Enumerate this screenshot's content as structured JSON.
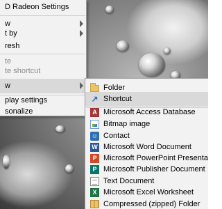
{
  "context_menu": {
    "items": [
      {
        "label": "D Radeon Settings",
        "disabled": false,
        "has_submenu": false
      },
      {
        "label": "w",
        "disabled": false,
        "has_submenu": true
      },
      {
        "label": "t by",
        "disabled": false,
        "has_submenu": true
      },
      {
        "label": "resh",
        "disabled": false,
        "has_submenu": false
      },
      {
        "label": "te",
        "disabled": true,
        "has_submenu": false
      },
      {
        "label": "te shortcut",
        "disabled": true,
        "has_submenu": false
      },
      {
        "label": "w",
        "disabled": false,
        "has_submenu": true,
        "highlighted": true
      },
      {
        "label": "play settings",
        "disabled": false,
        "has_submenu": false
      },
      {
        "label": "sonalize",
        "disabled": false,
        "has_submenu": false
      }
    ]
  },
  "new_submenu": {
    "items": [
      {
        "label": "Folder",
        "icon": "folder-icon"
      },
      {
        "label": "Shortcut",
        "icon": "shortcut-icon"
      },
      {
        "label": "Microsoft Access Database",
        "icon": "access-icon"
      },
      {
        "label": "Bitmap image",
        "icon": "bitmap-icon"
      },
      {
        "label": "Contact",
        "icon": "contact-icon"
      },
      {
        "label": "Microsoft Word Document",
        "icon": "word-icon"
      },
      {
        "label": "Microsoft PowerPoint Presentation",
        "icon": "powerpoint-icon"
      },
      {
        "label": "Microsoft Publisher Document",
        "icon": "publisher-icon"
      },
      {
        "label": "Text Document",
        "icon": "text-document-icon"
      },
      {
        "label": "Microsoft Excel Worksheet",
        "icon": "excel-icon"
      },
      {
        "label": "Compressed (zipped) Folder",
        "icon": "zip-folder-icon"
      }
    ]
  },
  "colors": {
    "menu_background": "#f2f2f2",
    "highlight": "#d9d9d9",
    "disabled_text": "#8a8a8a"
  }
}
